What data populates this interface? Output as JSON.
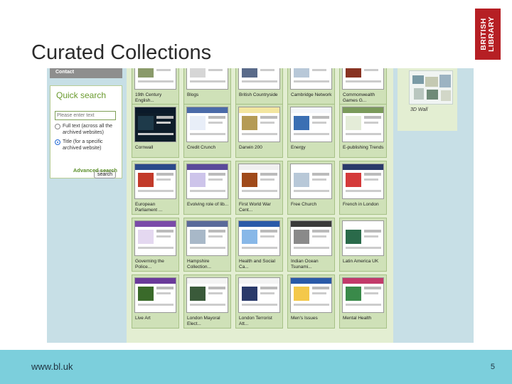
{
  "slide": {
    "title": "Curated Collections",
    "logo_text": "BRITISH\nLIBRARY",
    "footer_url": "www.bl.uk",
    "page_number": "5"
  },
  "screenshot": {
    "contact": "Contact",
    "quick_search": {
      "title": "Quick search",
      "placeholder": "Please enter text",
      "option_full": "Full text (across all the archived websites)",
      "option_title": "Title (for a specific archived website)",
      "selected": "title",
      "search_button": "search",
      "advanced": "Advanced search"
    },
    "collections": [
      "19th Century English...",
      "Blogs",
      "British Countryside",
      "Cambridge Network",
      "Commonwealth Games G...",
      "Cornwall",
      "Credit Crunch",
      "Darwin 200",
      "Energy",
      "E-publishing Trends",
      "European Parliament ...",
      "Evolving role of lib...",
      "First World War Cent...",
      "Free Church",
      "French in London",
      "Governing the Police...",
      "Hampshire Collection...",
      "Health and Social Ca...",
      "Indian Ocean Tsunami...",
      "Latin America UK",
      "Live Art",
      "London Mayoral Elect...",
      "London Terrorist Att...",
      "Men's Issues",
      "Mental Health"
    ],
    "featured_label": "3D Wall"
  }
}
